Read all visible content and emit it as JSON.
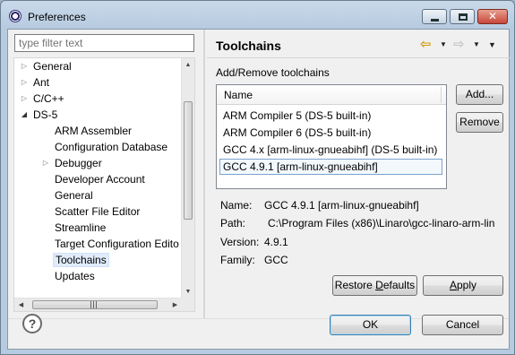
{
  "window": {
    "title": "Preferences"
  },
  "filter": {
    "placeholder": "type filter text"
  },
  "tree": {
    "items": [
      {
        "label": "General",
        "expander": "▷"
      },
      {
        "label": "Ant",
        "expander": "▷"
      },
      {
        "label": "C/C++",
        "expander": "▷"
      },
      {
        "label": "DS-5",
        "expander": "◢"
      },
      {
        "label": "ARM Assembler",
        "expander": ""
      },
      {
        "label": "Configuration Database",
        "expander": ""
      },
      {
        "label": "Debugger",
        "expander": "▷"
      },
      {
        "label": "Developer Account",
        "expander": ""
      },
      {
        "label": "General",
        "expander": ""
      },
      {
        "label": "Scatter File Editor",
        "expander": ""
      },
      {
        "label": "Streamline",
        "expander": ""
      },
      {
        "label": "Target Configuration Edito",
        "expander": ""
      },
      {
        "label": "Toolchains",
        "expander": ""
      },
      {
        "label": "Updates",
        "expander": ""
      }
    ]
  },
  "page": {
    "title": "Toolchains",
    "section_label": "Add/Remove toolchains",
    "table": {
      "header": "Name",
      "rows": [
        "ARM Compiler 5 (DS-5 built-in)",
        "ARM Compiler 6 (DS-5 built-in)",
        "GCC 4.x [arm-linux-gnueabihf] (DS-5 built-in)",
        "GCC 4.9.1 [arm-linux-gnueabihf]"
      ],
      "selected_index": 3
    },
    "add_label": "Add...",
    "remove_label": "Remove",
    "details": {
      "name_key": "Name:",
      "name_val": "GCC 4.9.1 [arm-linux-gnueabihf]",
      "path_key": "Path:",
      "path_val": "C:\\Program Files (x86)\\Linaro\\gcc-linaro-arm-lin",
      "version_key": "Version:",
      "version_val": "4.9.1",
      "family_key": "Family:",
      "family_val": "GCC"
    },
    "restore_defaults_pre": "Restore ",
    "restore_defaults_mnemonic": "D",
    "restore_defaults_post": "efaults",
    "apply_mnemonic": "A",
    "apply_post": "pply"
  },
  "footer": {
    "ok_label": "OK",
    "cancel_label": "Cancel"
  },
  "icons": {
    "back": "arrow-left-icon",
    "forward": "arrow-right-icon",
    "help": "help-icon",
    "app": "eclipse-icon"
  }
}
